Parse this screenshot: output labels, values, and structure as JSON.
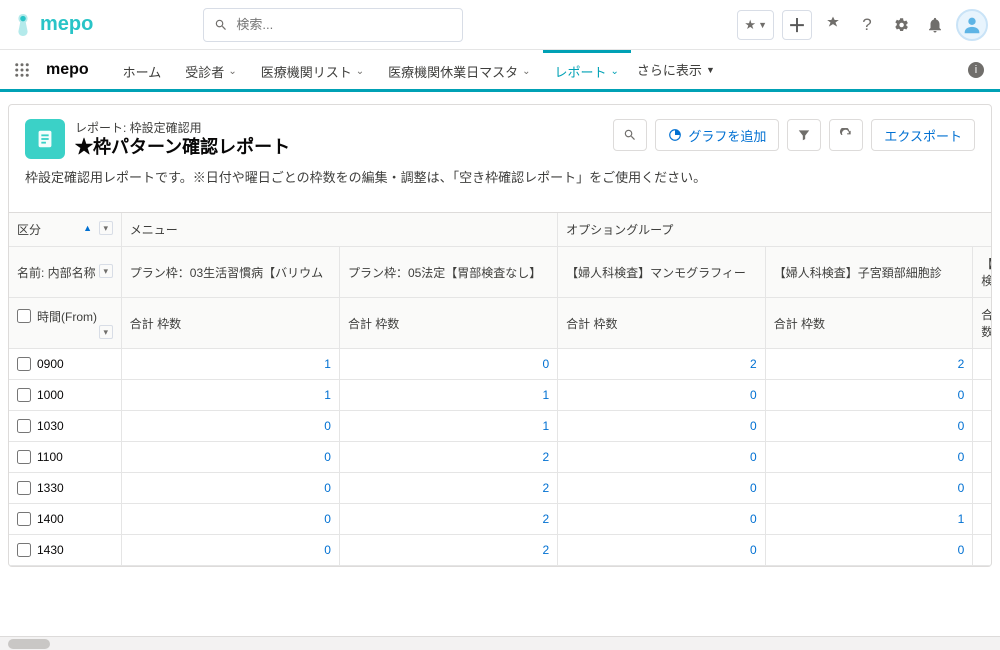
{
  "brand": {
    "name": "mepo"
  },
  "search": {
    "placeholder": "検索..."
  },
  "nav": {
    "app_name": "mepo",
    "tabs": [
      {
        "label": "ホーム"
      },
      {
        "label": "受診者"
      },
      {
        "label": "医療機関リスト"
      },
      {
        "label": "医療機関休業日マスタ"
      },
      {
        "label": "レポート",
        "active": true
      }
    ],
    "more_label": "さらに表示"
  },
  "report": {
    "eyebrow": "レポート: 枠設定確認用",
    "title": "★枠パターン確認レポート",
    "description": "枠設定確認用レポートです。※日付や曜日ごとの枠数をの編集・調整は、「空き枠確認レポート」をご使用ください。",
    "actions": {
      "add_chart": "グラフを追加",
      "export": "エクスポート"
    }
  },
  "grid": {
    "side_header1": "区分",
    "side_header2": "名前: 内部名称",
    "side_header3": "時間(From)",
    "group1_label": "メニュー",
    "group2_label": "オプショングループ",
    "columns": [
      "プラン枠：03生活習慣病【バリウム",
      "プラン枠：05法定【胃部検査なし】",
      "【婦人科検査】マンモグラフィー",
      "【婦人科検査】子宮頚部細胞診",
      "【婦人科検"
    ],
    "subhead": "合計 枠数",
    "rows": [
      {
        "time": "0900",
        "v": [
          1,
          0,
          2,
          2
        ]
      },
      {
        "time": "1000",
        "v": [
          1,
          1,
          0,
          0
        ]
      },
      {
        "time": "1030",
        "v": [
          0,
          1,
          0,
          0
        ]
      },
      {
        "time": "1100",
        "v": [
          0,
          2,
          0,
          0
        ]
      },
      {
        "time": "1330",
        "v": [
          0,
          2,
          0,
          0
        ]
      },
      {
        "time": "1400",
        "v": [
          0,
          2,
          0,
          1
        ]
      },
      {
        "time": "1430",
        "v": [
          0,
          2,
          0,
          0
        ]
      }
    ]
  }
}
